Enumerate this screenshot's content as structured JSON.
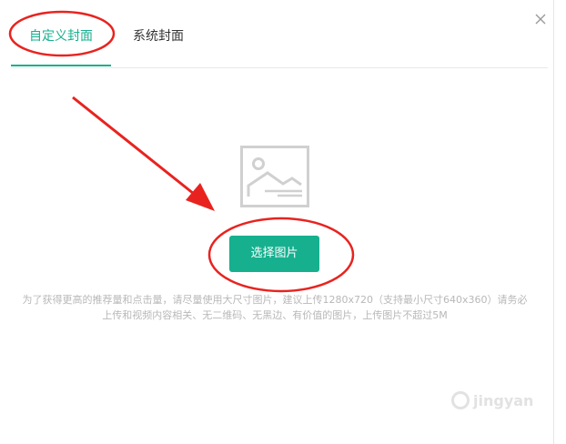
{
  "tabs": [
    {
      "label": "自定义封面",
      "active": true
    },
    {
      "label": "系统封面",
      "active": false
    }
  ],
  "close_icon": "close-icon",
  "placeholder_icon": "image-placeholder-icon",
  "select_button": {
    "label": "选择图片"
  },
  "hint": {
    "line1": "为了获得更高的推荐量和点击量，请尽量使用大尺寸图片，建议上传1280x720（支持最小尺寸640x360）请务必",
    "line2": "上传和视频内容相关、无二维码、无黑边、有价值的图片，上传图片不超过5M"
  },
  "watermark": {
    "text": "jingyan"
  },
  "colors": {
    "accent": "#16b08f",
    "annotation": "#e8231f",
    "hint_text": "#b8b8b8"
  }
}
